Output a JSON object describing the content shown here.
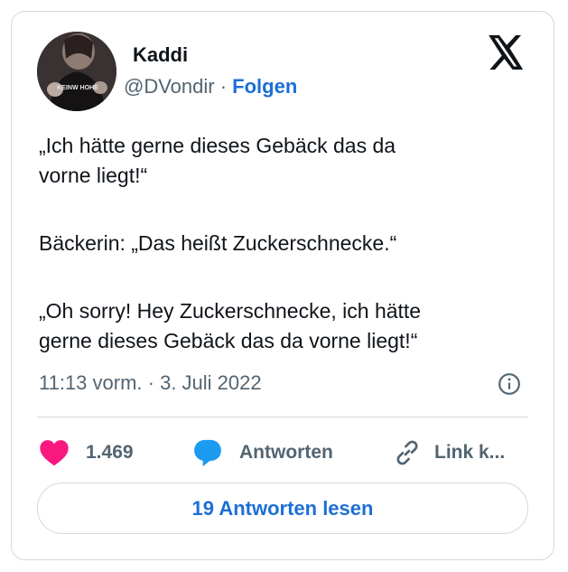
{
  "author": {
    "name": "Kaddi",
    "handle": "@DVondir",
    "separator": " · ",
    "follow_label": "Folgen",
    "avatar_shirt_text": "KEINW HOHE"
  },
  "tweet": {
    "lines": [
      "„Ich hätte gerne dieses Gebäck das da",
      "vorne liegt!“",
      "Bäckerin: „Das heißt Zuckerschnecke.“",
      "„Oh sorry! Hey Zuckerschnecke, ich hätte",
      "gerne dieses Gebäck das da vorne liegt!“"
    ],
    "timestamp": "11:13 vorm. · 3. Juli 2022"
  },
  "actions": {
    "like_count": "1.469",
    "reply_label": "Antworten",
    "link_label": "Link k..."
  },
  "read_replies_label": "19 Antworten lesen",
  "colors": {
    "accent": "#1d6fd6",
    "like": "#f91880",
    "reply": "#1d9bf0",
    "secondary_text": "#536471",
    "border": "#cfd9de"
  },
  "icons": [
    "x-logo-icon",
    "info-icon",
    "heart-icon",
    "reply-bubble-icon",
    "link-icon"
  ]
}
